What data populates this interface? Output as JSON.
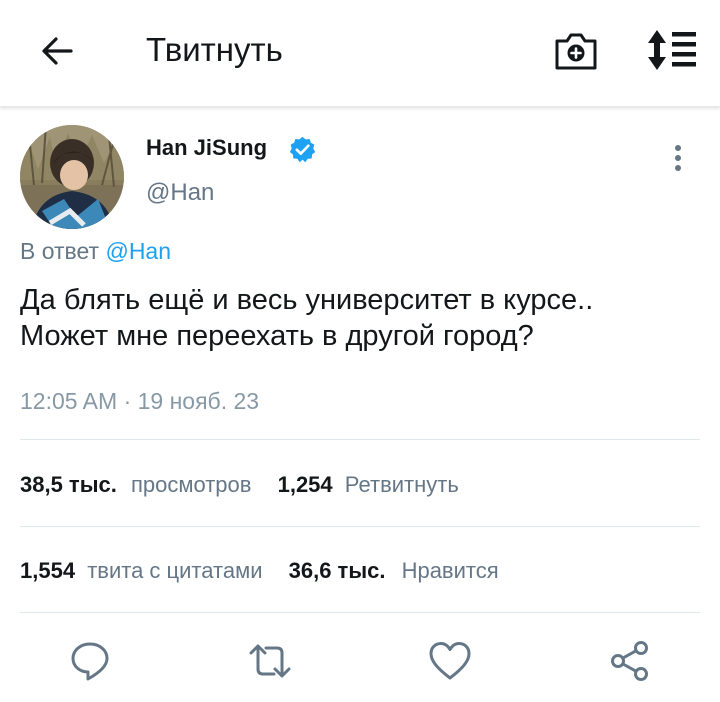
{
  "header": {
    "title": "Твитнуть",
    "back_icon": "arrow-left-icon",
    "camera_icon": "camera-plus-icon",
    "sort_icon": "sort-list-icon"
  },
  "tweet": {
    "author_name": "Han JiSung",
    "verified_icon": "verified-badge-icon",
    "handle": "@Han",
    "reply_prefix": "В ответ",
    "reply_to": "@Han",
    "text_lines": [
      "Да блять ещё и весь университет в курсе..",
      "Может мне переехать в другой город?"
    ],
    "timestamp": "12:05 AM · 19 нояб. 23"
  },
  "stats": {
    "views_count": "38,5 тыс.",
    "views_label": "просмотров",
    "retweets_count": "1,254",
    "retweets_label": "Ретвитнуть",
    "quotes_count": "1,554",
    "quotes_label": "твита с цитатами",
    "likes_count": "36,6 тыс.",
    "likes_label": "Нравится"
  },
  "actions": [
    "reply-icon",
    "retweet-icon",
    "like-icon",
    "share-icon"
  ],
  "colors": {
    "accent": "#1da1f2",
    "secondary_text": "#657786",
    "divider": "#e1e8ed"
  }
}
